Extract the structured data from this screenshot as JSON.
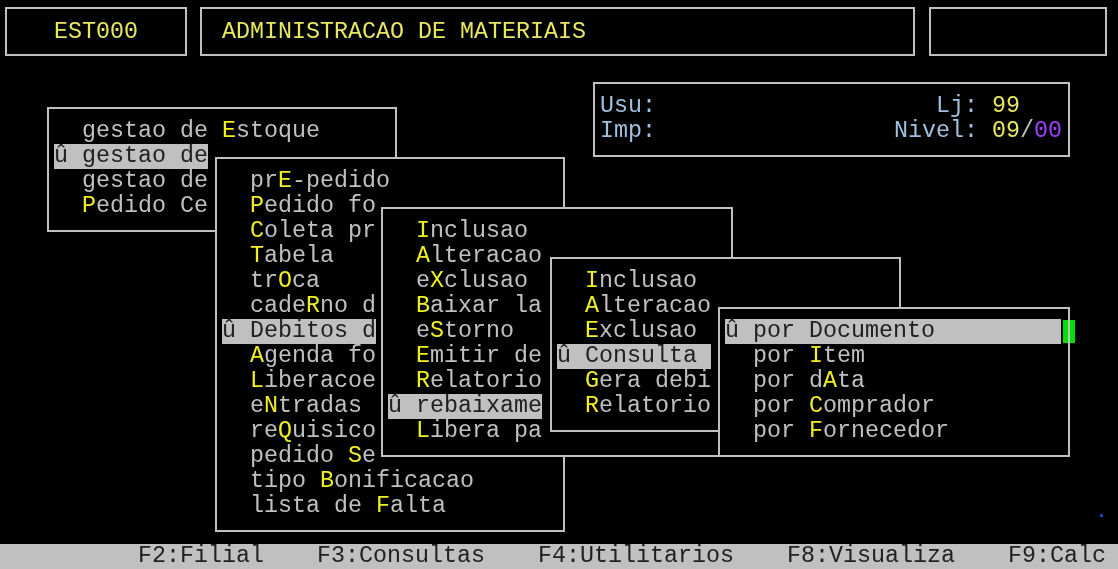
{
  "header": {
    "code": "EST000",
    "title": "ADMINISTRACAO DE MATERIAIS"
  },
  "info": {
    "user_label": "Usu:",
    "printer_label": "Imp:",
    "store_label": "Lj:",
    "store_value": "99",
    "level_label": "Nivel:",
    "level_current": "09",
    "level_separator": "/",
    "level_max": "00"
  },
  "menus": [
    {
      "items": [
        {
          "selected": false,
          "parts": [
            {
              "text": "gestao de "
            },
            {
              "text": "E",
              "hotkey": true
            },
            {
              "text": "stoque"
            }
          ]
        },
        {
          "selected": true,
          "marker": "û",
          "parts": [
            {
              "text": "gestao de"
            }
          ]
        },
        {
          "selected": false,
          "parts": [
            {
              "text": "gestao de"
            }
          ]
        },
        {
          "selected": false,
          "parts": [
            {
              "text": "P",
              "hotkey": true
            },
            {
              "text": "edido Ce"
            }
          ]
        }
      ]
    },
    {
      "items": [
        {
          "selected": false,
          "parts": [
            {
              "text": "pr"
            },
            {
              "text": "E",
              "hotkey": true
            },
            {
              "text": "-pedido"
            }
          ]
        },
        {
          "selected": false,
          "parts": [
            {
              "text": "P",
              "hotkey": true
            },
            {
              "text": "edido fo"
            }
          ]
        },
        {
          "selected": false,
          "parts": [
            {
              "text": "C",
              "hotkey": true
            },
            {
              "text": "oleta pr"
            }
          ]
        },
        {
          "selected": false,
          "parts": [
            {
              "text": "T",
              "hotkey": true
            },
            {
              "text": "abela"
            }
          ]
        },
        {
          "selected": false,
          "parts": [
            {
              "text": "tr"
            },
            {
              "text": "O",
              "hotkey": true
            },
            {
              "text": "ca"
            }
          ]
        },
        {
          "selected": false,
          "parts": [
            {
              "text": "cade"
            },
            {
              "text": "R",
              "hotkey": true
            },
            {
              "text": "no d"
            }
          ]
        },
        {
          "selected": true,
          "marker": "û",
          "parts": [
            {
              "text": "Debitos d"
            }
          ]
        },
        {
          "selected": false,
          "parts": [
            {
              "text": "A",
              "hotkey": true
            },
            {
              "text": "genda fo"
            }
          ]
        },
        {
          "selected": false,
          "parts": [
            {
              "text": "L",
              "hotkey": true
            },
            {
              "text": "iberacoe"
            }
          ]
        },
        {
          "selected": false,
          "parts": [
            {
              "text": "e"
            },
            {
              "text": "N",
              "hotkey": true
            },
            {
              "text": "tradas"
            }
          ]
        },
        {
          "selected": false,
          "parts": [
            {
              "text": "re"
            },
            {
              "text": "Q",
              "hotkey": true
            },
            {
              "text": "uisico"
            }
          ]
        },
        {
          "selected": false,
          "parts": [
            {
              "text": "pedido "
            },
            {
              "text": "S",
              "hotkey": true
            },
            {
              "text": "e"
            }
          ]
        },
        {
          "selected": false,
          "parts": [
            {
              "text": "tipo "
            },
            {
              "text": "B",
              "hotkey": true
            },
            {
              "text": "onificacao"
            }
          ]
        },
        {
          "selected": false,
          "parts": [
            {
              "text": "lista de "
            },
            {
              "text": "F",
              "hotkey": true
            },
            {
              "text": "alta"
            }
          ]
        }
      ]
    },
    {
      "items": [
        {
          "selected": false,
          "parts": [
            {
              "text": "I",
              "hotkey": true
            },
            {
              "text": "nclusao"
            }
          ]
        },
        {
          "selected": false,
          "parts": [
            {
              "text": "A",
              "hotkey": true
            },
            {
              "text": "lteracao"
            }
          ]
        },
        {
          "selected": false,
          "parts": [
            {
              "text": "e"
            },
            {
              "text": "X",
              "hotkey": true
            },
            {
              "text": "clusao"
            }
          ]
        },
        {
          "selected": false,
          "parts": [
            {
              "text": "B",
              "hotkey": true
            },
            {
              "text": "aixar la"
            }
          ]
        },
        {
          "selected": false,
          "parts": [
            {
              "text": "e"
            },
            {
              "text": "S",
              "hotkey": true
            },
            {
              "text": "torno"
            }
          ]
        },
        {
          "selected": false,
          "parts": [
            {
              "text": "E",
              "hotkey": true
            },
            {
              "text": "mitir de"
            }
          ]
        },
        {
          "selected": false,
          "parts": [
            {
              "text": "R",
              "hotkey": true
            },
            {
              "text": "elatorio"
            }
          ]
        },
        {
          "selected": true,
          "marker": "û",
          "parts": [
            {
              "text": "rebaixame"
            }
          ]
        },
        {
          "selected": false,
          "parts": [
            {
              "text": "L",
              "hotkey": true
            },
            {
              "text": "ibera pa"
            }
          ]
        }
      ]
    },
    {
      "items": [
        {
          "selected": false,
          "parts": [
            {
              "text": "I",
              "hotkey": true
            },
            {
              "text": "nclusao"
            }
          ]
        },
        {
          "selected": false,
          "parts": [
            {
              "text": "A",
              "hotkey": true
            },
            {
              "text": "lteracao"
            }
          ]
        },
        {
          "selected": false,
          "parts": [
            {
              "text": "E",
              "hotkey": true
            },
            {
              "text": "xclusao"
            }
          ]
        },
        {
          "selected": true,
          "marker": "û",
          "parts": [
            {
              "text": "Consulta"
            }
          ]
        },
        {
          "selected": false,
          "parts": [
            {
              "text": "G",
              "hotkey": true
            },
            {
              "text": "era debi"
            }
          ]
        },
        {
          "selected": false,
          "parts": [
            {
              "text": "R",
              "hotkey": true
            },
            {
              "text": "elatorio"
            }
          ]
        }
      ]
    },
    {
      "items": [
        {
          "selected": true,
          "marker": "û",
          "parts": [
            {
              "text": "por Documento"
            }
          ]
        },
        {
          "selected": false,
          "parts": [
            {
              "text": "por "
            },
            {
              "text": "I",
              "hotkey": true
            },
            {
              "text": "tem"
            }
          ]
        },
        {
          "selected": false,
          "parts": [
            {
              "text": "por d"
            },
            {
              "text": "A",
              "hotkey": true
            },
            {
              "text": "ta"
            }
          ]
        },
        {
          "selected": false,
          "parts": [
            {
              "text": "por "
            },
            {
              "text": "C",
              "hotkey": true
            },
            {
              "text": "omprador"
            }
          ]
        },
        {
          "selected": false,
          "parts": [
            {
              "text": "por "
            },
            {
              "text": "F",
              "hotkey": true
            },
            {
              "text": "ornecedor"
            }
          ]
        }
      ]
    }
  ],
  "function_keys": [
    "F2:Filial",
    "F3:Consultas",
    "F4:Utilitarios",
    "F8:Visualiza",
    "F9:Calc"
  ]
}
